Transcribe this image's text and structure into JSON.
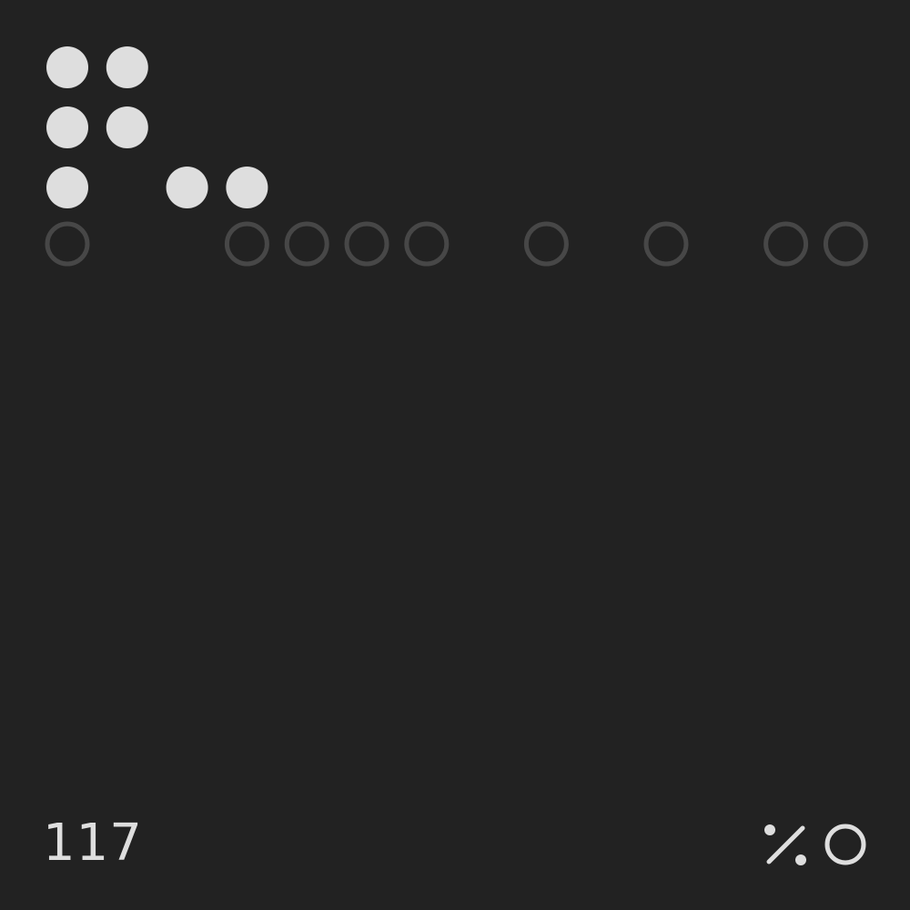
{
  "colors": {
    "background": "#222222",
    "filled_dot": "#dedede",
    "empty_ring": "#474747",
    "foreground": "#dedede"
  },
  "dot_grid": {
    "columns": 14,
    "filled_rows": [
      [
        1,
        1,
        0,
        0,
        0,
        0,
        0,
        0,
        0,
        0,
        0,
        0,
        0,
        0
      ],
      [
        1,
        1,
        0,
        0,
        0,
        0,
        0,
        0,
        0,
        0,
        0,
        0,
        0,
        0
      ],
      [
        1,
        0,
        1,
        1,
        0,
        0,
        0,
        0,
        0,
        0,
        0,
        0,
        0,
        0
      ]
    ],
    "ring_row": [
      1,
      0,
      0,
      1,
      1,
      1,
      1,
      0,
      1,
      0,
      1,
      0,
      1,
      1
    ]
  },
  "footer": {
    "counter": "117",
    "icons": [
      "percent-icon",
      "ring-icon"
    ]
  }
}
